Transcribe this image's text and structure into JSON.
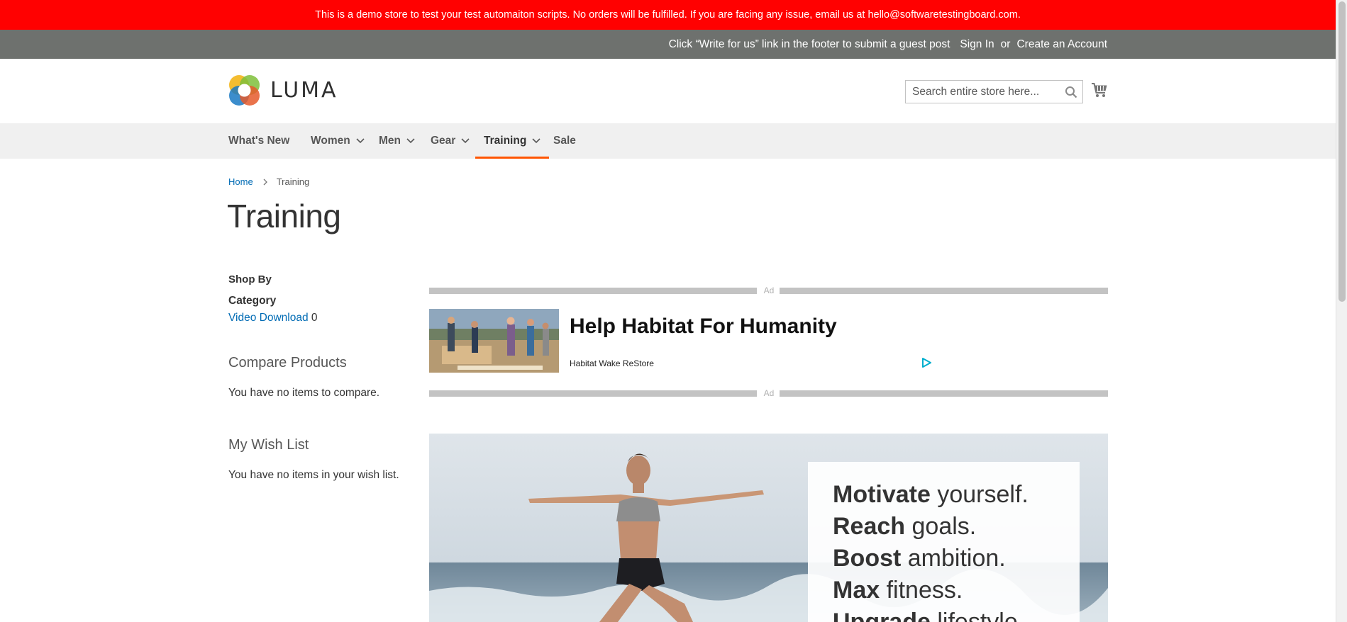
{
  "demo_notice": "This is a demo store to test your test automaiton scripts. No orders will be fulfilled. If you are facing any issue, email us at hello@softwaretestingboard.com.",
  "header_panel": {
    "guest_post": "Click “Write for us” link in the footer to submit a guest post",
    "sign_in": "Sign In",
    "or": "or",
    "create_account": "Create an Account"
  },
  "logo": {
    "text": "LUMA"
  },
  "search": {
    "placeholder": "Search entire store here..."
  },
  "nav": {
    "items": [
      {
        "label": "What's New"
      },
      {
        "label": "Women"
      },
      {
        "label": "Men"
      },
      {
        "label": "Gear"
      },
      {
        "label": "Training"
      },
      {
        "label": "Sale"
      }
    ]
  },
  "breadcrumb": {
    "home": "Home",
    "current": "Training"
  },
  "page_title": "Training",
  "sidebar": {
    "shop_by": "Shop By",
    "category_title": "Category",
    "category_item": {
      "name": "Video Download",
      "count": "0"
    },
    "compare_title": "Compare Products",
    "compare_empty": "You have no items to compare.",
    "wish_title": "My Wish List",
    "wish_empty": "You have no items in your wish list."
  },
  "ad": {
    "label": "Ad",
    "headline": "Help Habitat For Humanity",
    "source": "Habitat Wake ReStore"
  },
  "banner": {
    "lines": [
      {
        "bold": "Motivate",
        "rest": " yourself."
      },
      {
        "bold": "Reach",
        "rest": " goals."
      },
      {
        "bold": "Boost",
        "rest": " ambition."
      },
      {
        "bold": "Max",
        "rest": " fitness."
      },
      {
        "bold": "Upgrade",
        "rest": " lifestyle."
      }
    ]
  },
  "colors": {
    "demo_bar": "#ff0101",
    "panel_header": "#6e716e",
    "link": "#006bb4",
    "nav_active": "#ff5501"
  }
}
